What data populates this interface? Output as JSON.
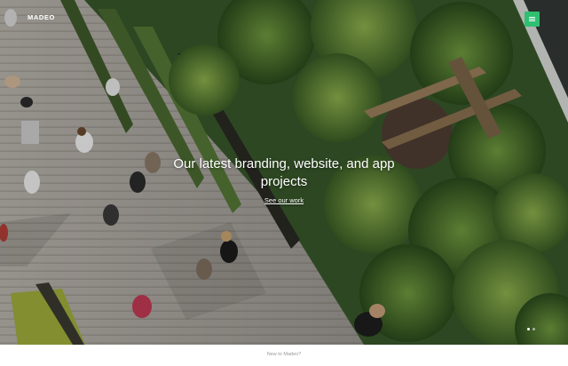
{
  "header": {
    "logo_text": "MADEO",
    "menu_icon": "hamburger-menu-icon",
    "menu_color": "#2fbf71"
  },
  "hero": {
    "headline": "Our latest branding, website, and app projects",
    "cta_label": "See our work",
    "slide_count": 2,
    "active_slide": 1
  },
  "footer": {
    "link_text": "New to Madeo?"
  }
}
